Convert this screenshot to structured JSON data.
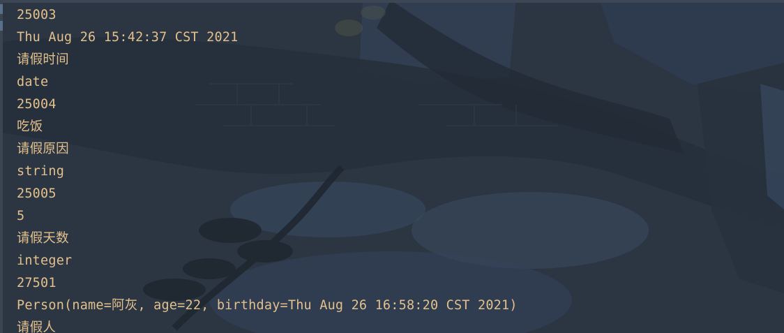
{
  "console": {
    "lines": [
      "25003",
      "Thu Aug 26 15:42:37 CST 2021",
      "请假时间",
      "date",
      "25004",
      "吃饭",
      "请假原因",
      "string",
      "25005",
      "5",
      "请假天数",
      "integer",
      "27501",
      "Person(name=阿灰, age=22, birthday=Thu Aug 26 16:58:20 CST 2021)",
      "请假人"
    ],
    "text_color": "#e2c08d",
    "background_color": "#2b3440"
  }
}
